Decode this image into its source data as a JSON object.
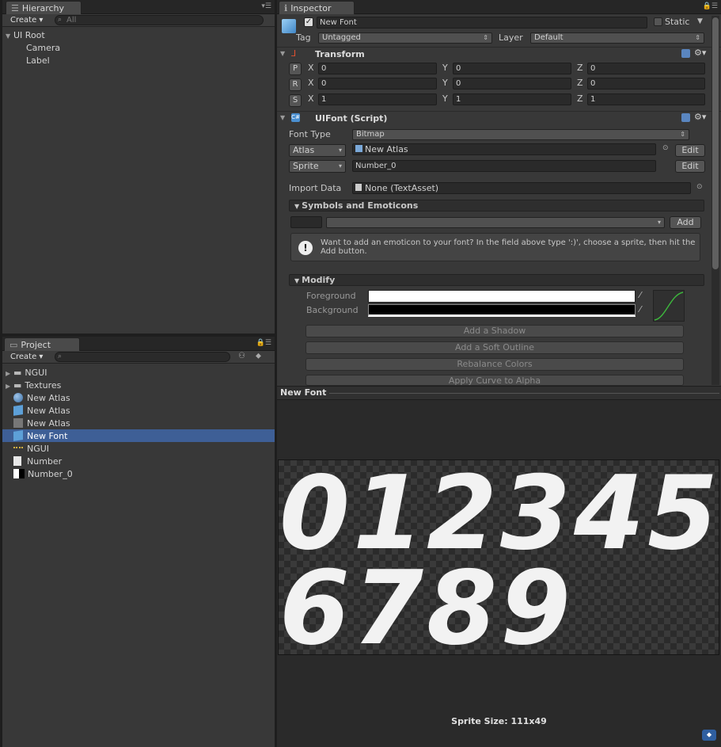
{
  "hierarchy": {
    "tab": "Hierarchy",
    "create": "Create",
    "search_placeholder": "All",
    "items": [
      "UI Root",
      "Camera",
      "Label"
    ]
  },
  "project": {
    "tab": "Project",
    "create": "Create",
    "items": [
      "NGUI",
      "Textures",
      "New Atlas",
      "New Atlas",
      "New Atlas",
      "New Font",
      "NGUI",
      "Number",
      "Number_0"
    ]
  },
  "inspector": {
    "tab": "Inspector",
    "object_name": "New Font",
    "static_label": "Static",
    "tag_label": "Tag",
    "tag_value": "Untagged",
    "layer_label": "Layer",
    "layer_value": "Default",
    "transform": {
      "title": "Transform",
      "rows": [
        {
          "btn": "P",
          "x": "0",
          "y": "0",
          "z": "0"
        },
        {
          "btn": "R",
          "x": "0",
          "y": "0",
          "z": "0"
        },
        {
          "btn": "S",
          "x": "1",
          "y": "1",
          "z": "1"
        }
      ],
      "axis_x": "X",
      "axis_y": "Y",
      "axis_z": "Z"
    },
    "uifont": {
      "title": "UIFont (Script)",
      "font_type_label": "Font Type",
      "font_type_value": "Bitmap",
      "atlas_dd": "Atlas",
      "atlas_value": "New Atlas",
      "sprite_dd": "Sprite",
      "sprite_value": "Number_0",
      "edit": "Edit",
      "import_label": "Import Data",
      "import_value": "None (TextAsset)",
      "symbols_title": "Symbols and Emoticons",
      "add": "Add",
      "help_text": "Want to add an emoticon to your font? In the field above type ':)', choose a sprite, then hit the Add button.",
      "modify_title": "Modify",
      "foreground": "Foreground",
      "background": "Background",
      "buttons": [
        "Add a Shadow",
        "Add a Soft Outline",
        "Rebalance Colors",
        "Apply Curve to Alpha"
      ]
    }
  },
  "preview": {
    "title": "New Font",
    "digits_row1": [
      "0",
      "1",
      "2",
      "3",
      "4",
      "5"
    ],
    "digits_row2": [
      "6",
      "7",
      "8",
      "9"
    ],
    "sprite_size": "Sprite Size: 111x49"
  }
}
